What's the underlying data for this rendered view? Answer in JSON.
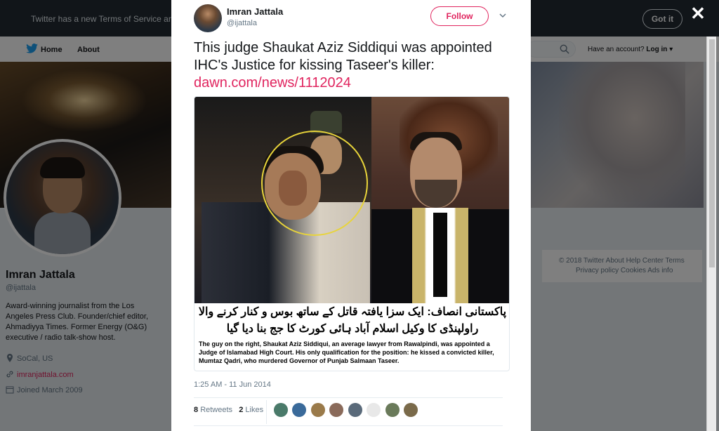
{
  "notice": {
    "text": "Twitter has a new Terms of Service and P",
    "button": "Got it"
  },
  "nav": {
    "home": "Home",
    "about": "About",
    "have_account": "Have an account?",
    "login": "Log in"
  },
  "profile": {
    "name": "Imran Jattala",
    "handle": "@ijattala",
    "bio": "Award-winning journalist from the Los Angeles Press Club. Founder/chief editor, Ahmadiyya Times. Former Energy (O&G) executive / radio talk-show host.",
    "location": "SoCal, US",
    "website": "imranjattala.com",
    "joined": "Joined March 2009"
  },
  "footer": {
    "line1": "© 2018 Twitter   About   Help Center   Terms",
    "line2": "Privacy policy   Cookies   Ads info"
  },
  "tweet": {
    "name": "Imran Jattala",
    "handle": "@ijattala",
    "follow": "Follow",
    "text": "This judge Shaukat Aziz Siddiqui was appointed IHC's Justice for kissing Taseer's killer: ",
    "link": "dawn.com/news/1112024",
    "media": {
      "urdu_line1": "پاکستانی انصاف: ایک سزا یافتہ قاتل کے ساتھ بوس و کنار کرنے والا",
      "urdu_line2": "راولپنڈی کا وکیل اسلام آباد ہائی کورٹ کا جج بنا دیا گیا",
      "caption": "The guy on the right, Shaukat Aziz Siddiqui, an average lawyer from Rawalpindi, was appointed a Judge of Islamabad High Court. His only qualification for the position: he kissed a convicted killer, Mumtaz Qadri, who murdered Governor of Punjab Salmaan Taseer."
    },
    "timestamp": "1:25 AM - 11 Jun 2014",
    "retweets_count": "8",
    "retweets_label": "Retweets",
    "likes_count": "2",
    "likes_label": "Likes"
  },
  "colors": {
    "accent": "#e0245e",
    "link_blue": "#1b95e0",
    "notice_bg": "#222a33"
  }
}
